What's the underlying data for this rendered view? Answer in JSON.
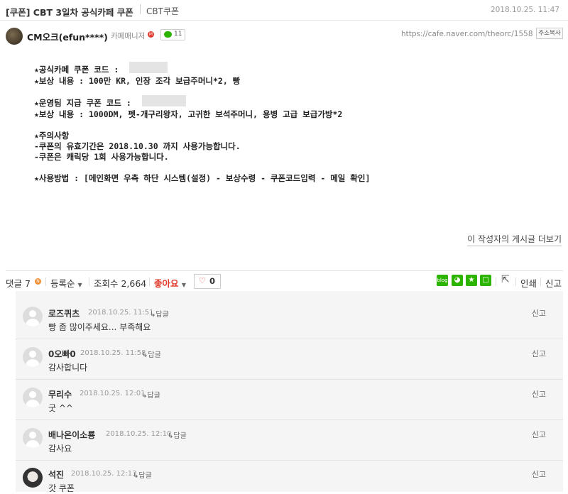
{
  "header": {
    "title": "[쿠폰] CBT 3일차 공식카페 쿠폰",
    "category": "CBT쿠폰",
    "date": "2018.10.25. 11:47"
  },
  "author": {
    "name": "CM오크(efun****)",
    "role": "카페매니저",
    "role_badge": "M",
    "comment_count": "11",
    "url": "https://cafe.naver.com/theorc/1558",
    "copy_label": "주소복사"
  },
  "post": {
    "line1": "★공식카페 쿠폰 코드 :",
    "line2": "★보상 내용 : 100만 KR, 인장 조각 보급주머니*2, 빵",
    "line3": "★운영팀 지급 쿠폰 코드 :",
    "line4": "★보상 내용 : 1000DM, 펫-개구리왕자, 고귀한 보석주머니, 용병 고급 보급가방*2",
    "line5": "★주의사항",
    "line6": "-쿠폰의 유효기간은 2018.10.30 까지 사용가능합니다.",
    "line7": "-쿠폰은 캐릭당 1회 사용가능합니다.",
    "line8": "★사용방법 : [메인화면 우측 하단 시스템(설정) - 보상수령 - 쿠폰코드입력 - 메일 확인]"
  },
  "more_link": "이 작성자의 게시글 더보기",
  "bar": {
    "comments_label": "댓글 7",
    "new_badge": "N",
    "sort_label": "등록순",
    "views_label": "조회수 2,664",
    "like_label": "좋아요",
    "like_count": "0",
    "print_label": "인쇄",
    "report_label": "신고",
    "blog_label": "blog"
  },
  "comments": [
    {
      "author": "로즈퀴츠",
      "time": "2018.10.25. 11:51",
      "reply": "답글",
      "text": "빵 좀 많이주세요... 부족해요",
      "report": "신고"
    },
    {
      "author": "0오빠0",
      "time": "2018.10.25. 11:58",
      "reply": "답글",
      "text": "감사합니다",
      "report": "신고"
    },
    {
      "author": "무리수",
      "time": "2018.10.25. 12:01",
      "reply": "답글",
      "text": "굿 ^^",
      "report": "신고"
    },
    {
      "author": "배나온이소룡",
      "time": "2018.10.25. 12:10",
      "reply": "답글",
      "text": "감사요",
      "report": "신고"
    },
    {
      "author": "석진",
      "time": "2018.10.25. 12:13",
      "reply": "답글",
      "text": "갓 쿠폰",
      "report": "신고"
    }
  ],
  "colors": {
    "like_red": "#e0392b",
    "naver_green": "#2db400",
    "badge_orange": "#f09033"
  }
}
